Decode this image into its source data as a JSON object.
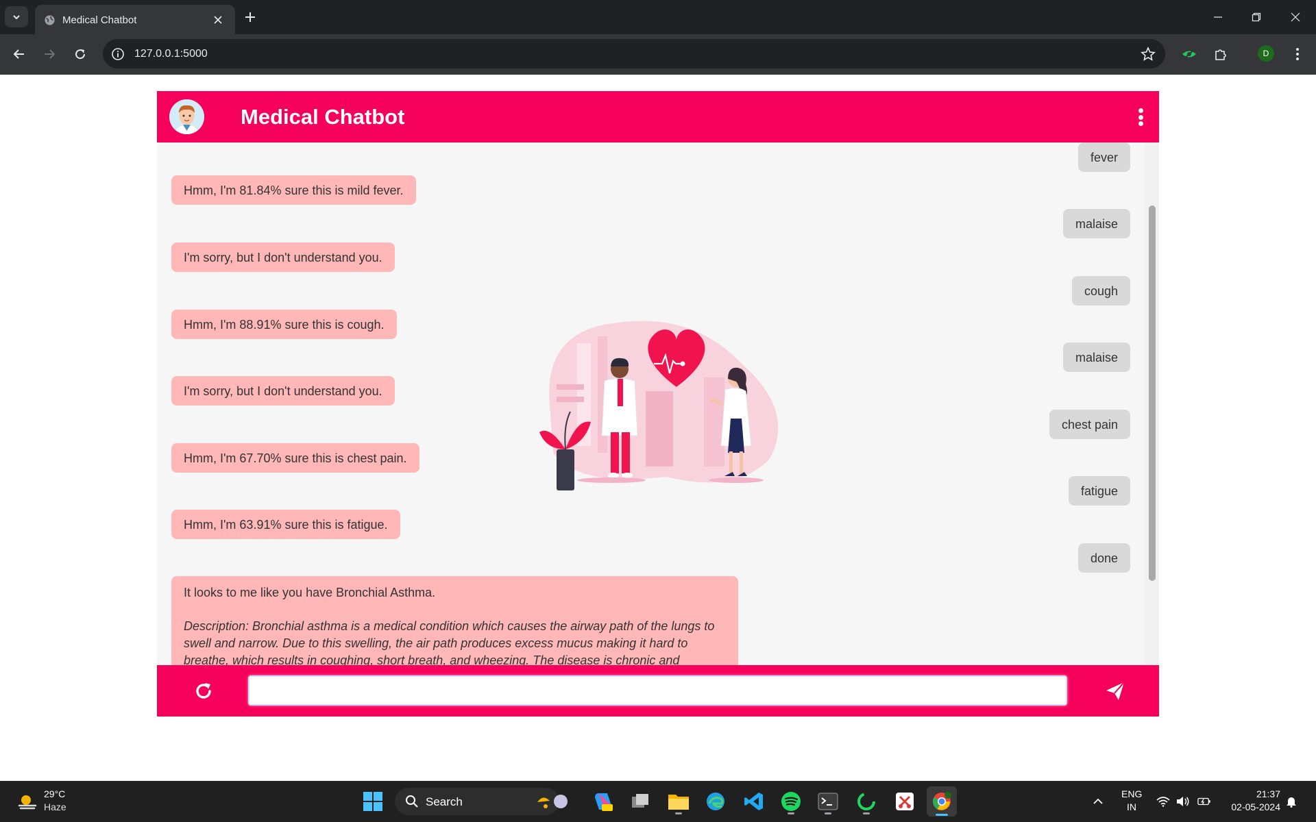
{
  "browser": {
    "tab_title": "Medical Chatbot",
    "url": "127.0.0.1:5000",
    "profile_initial": "D"
  },
  "chat": {
    "title": "Medical Chatbot",
    "input_value": "",
    "messages": [
      {
        "sender": "user",
        "text": "fever"
      },
      {
        "sender": "bot",
        "text": "Hmm, I'm 81.84% sure this is mild fever."
      },
      {
        "sender": "user",
        "text": "malaise"
      },
      {
        "sender": "bot",
        "text": "I'm sorry, but I don't understand you."
      },
      {
        "sender": "user",
        "text": "cough"
      },
      {
        "sender": "bot",
        "text": "Hmm, I'm 88.91% sure this is cough."
      },
      {
        "sender": "user",
        "text": "malaise"
      },
      {
        "sender": "bot",
        "text": "I'm sorry, but I don't understand you."
      },
      {
        "sender": "user",
        "text": "chest pain"
      },
      {
        "sender": "bot",
        "text": "Hmm, I'm 67.70% sure this is chest pain."
      },
      {
        "sender": "user",
        "text": "fatigue"
      },
      {
        "sender": "bot",
        "text": "Hmm, I'm 63.91% sure this is fatigue."
      },
      {
        "sender": "user",
        "text": "done"
      },
      {
        "sender": "bot",
        "text": "It looks to me like you have Bronchial Asthma.",
        "description": "Description: Bronchial asthma is a medical condition which causes the airway path of the lungs to swell and narrow. Due to this swelling, the air path produces excess mucus making it hard to breathe, which results in coughing, short breath, and wheezing. The disease is chronic and interferes with daily"
      }
    ],
    "colors": {
      "header": "#f5005a",
      "bot_bubble": "#ffb7b7",
      "user_bubble": "#d9d9d9",
      "background": "#f6f6f6"
    }
  },
  "taskbar": {
    "temperature": "29°C",
    "condition": "Haze",
    "search_label": "Search",
    "lang_line1": "ENG",
    "lang_line2": "IN",
    "time": "21:37",
    "date": "02-05-2024"
  },
  "icons": [
    "tab-list-icon",
    "globe-icon",
    "close-icon",
    "plus-icon",
    "minimize-icon",
    "restore-icon",
    "back-icon",
    "forward-icon",
    "reload-icon",
    "info-icon",
    "star-icon",
    "extension-icon",
    "puzzle-icon",
    "menu-icon",
    "avatar",
    "kebab-icon",
    "refresh-icon",
    "send-icon",
    "windows-icon",
    "search-icon"
  ]
}
